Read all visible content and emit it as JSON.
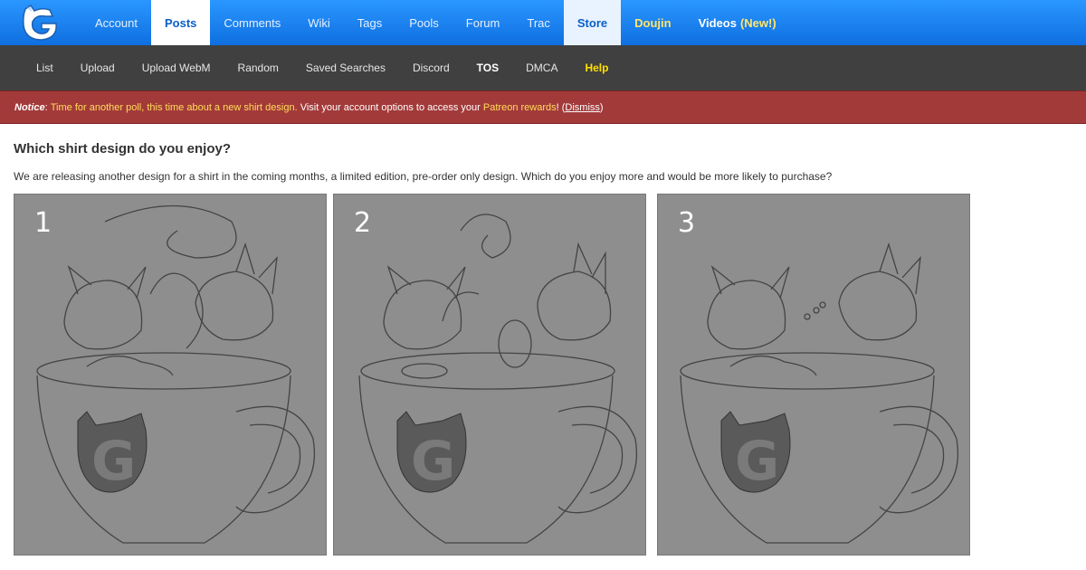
{
  "topnav": {
    "logo_icon": "g-cat-logo-icon",
    "items": [
      {
        "label": "Account"
      },
      {
        "label": "Posts"
      },
      {
        "label": "Comments"
      },
      {
        "label": "Wiki"
      },
      {
        "label": "Tags"
      },
      {
        "label": "Pools"
      },
      {
        "label": "Forum"
      },
      {
        "label": "Trac"
      },
      {
        "label": "Store"
      },
      {
        "label": "Doujin"
      },
      {
        "label": "Videos"
      }
    ],
    "videos_new": "(New!)",
    "accent_color": "#1a83f2",
    "highlight_color": "#ffe66d"
  },
  "subnav": {
    "items": [
      {
        "label": "List"
      },
      {
        "label": "Upload"
      },
      {
        "label": "Upload WebM"
      },
      {
        "label": "Random"
      },
      {
        "label": "Saved Searches"
      },
      {
        "label": "Discord"
      },
      {
        "label": "TOS"
      },
      {
        "label": "DMCA"
      },
      {
        "label": "Help"
      }
    ]
  },
  "notice": {
    "label": "Notice",
    "poll_link": "Time for another poll, this time about a new shirt design.",
    "middle_text": " Visit your account options to access your ",
    "patreon_link": "Patreon rewards",
    "end_text": "! (",
    "dismiss": "Dismiss",
    "close_paren": ")",
    "background_color": "#a33a3a"
  },
  "main": {
    "title": "Which shirt design do you enjoy?",
    "description": "We are releasing another design for a shirt in the coming months, a limited edition, pre-order only design. Which do you enjoy more and would be more likely to purchase?",
    "options": [
      {
        "number": "1"
      },
      {
        "number": "2"
      },
      {
        "number": "3"
      }
    ]
  }
}
